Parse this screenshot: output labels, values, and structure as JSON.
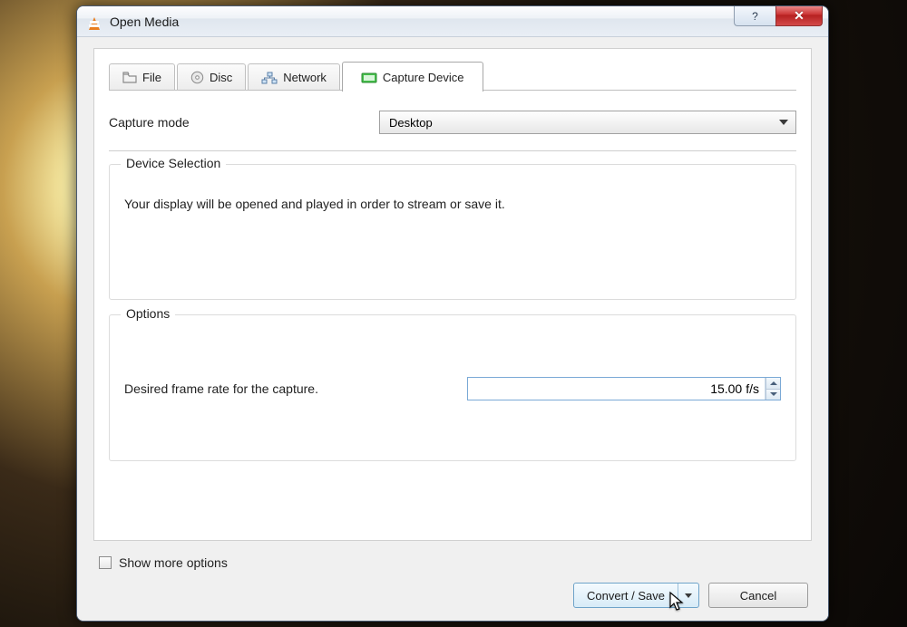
{
  "window": {
    "title": "Open Media"
  },
  "tabs": {
    "file": "File",
    "disc": "Disc",
    "network": "Network",
    "capture": "Capture Device"
  },
  "capture_mode": {
    "label": "Capture mode",
    "selected": "Desktop"
  },
  "device_selection": {
    "legend": "Device Selection",
    "text": "Your display will be opened and played in order to stream or save it."
  },
  "options": {
    "legend": "Options",
    "frame_rate_label": "Desired frame rate for the capture.",
    "frame_rate_value": "15.00",
    "frame_rate_units": "f/s"
  },
  "footer": {
    "show_more": "Show more options",
    "primary": "Convert / Save",
    "cancel": "Cancel"
  },
  "titlebar": {
    "help": "?"
  }
}
